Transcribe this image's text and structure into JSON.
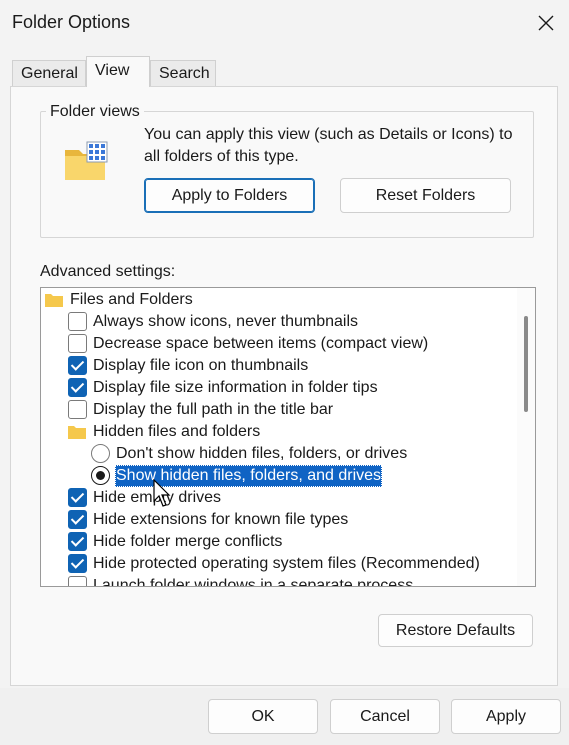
{
  "window": {
    "title": "Folder Options"
  },
  "tabs": [
    {
      "label": "General"
    },
    {
      "label": "View"
    },
    {
      "label": "Search"
    }
  ],
  "folder_views": {
    "legend": "Folder views",
    "description": "You can apply this view (such as Details or Icons) to all folders of this type.",
    "apply_label": "Apply to Folders",
    "reset_label": "Reset Folders"
  },
  "advanced": {
    "label": "Advanced settings:",
    "items": [
      {
        "type": "folder",
        "text": "Files and Folders"
      },
      {
        "type": "checkbox",
        "text": "Always show icons, never thumbnails",
        "checked": false
      },
      {
        "type": "checkbox",
        "text": "Decrease space between items (compact view)",
        "checked": false
      },
      {
        "type": "checkbox",
        "text": "Display file icon on thumbnails",
        "checked": true
      },
      {
        "type": "checkbox",
        "text": "Display file size information in folder tips",
        "checked": true
      },
      {
        "type": "checkbox",
        "text": "Display the full path in the title bar",
        "checked": false
      },
      {
        "type": "folder",
        "text": "Hidden files and folders"
      },
      {
        "type": "radio",
        "text": "Don't show hidden files, folders, or drives",
        "checked": false
      },
      {
        "type": "radio",
        "text": "Show hidden files, folders, and drives",
        "checked": true
      },
      {
        "type": "checkbox",
        "text": "Hide empty drives",
        "checked": true
      },
      {
        "type": "checkbox",
        "text": "Hide extensions for known file types",
        "checked": true
      },
      {
        "type": "checkbox",
        "text": "Hide folder merge conflicts",
        "checked": true
      },
      {
        "type": "checkbox",
        "text": "Hide protected operating system files (Recommended)",
        "checked": true
      },
      {
        "type": "checkbox",
        "text": "Launch folder windows in a separate process",
        "checked": false
      }
    ]
  },
  "restore_label": "Restore Defaults",
  "footer": {
    "ok_label": "OK",
    "cancel_label": "Cancel",
    "apply_label": "Apply"
  },
  "colors": {
    "accent": "#0f63b4",
    "selection": "#0f63c4",
    "folder": "#f5c84c"
  }
}
